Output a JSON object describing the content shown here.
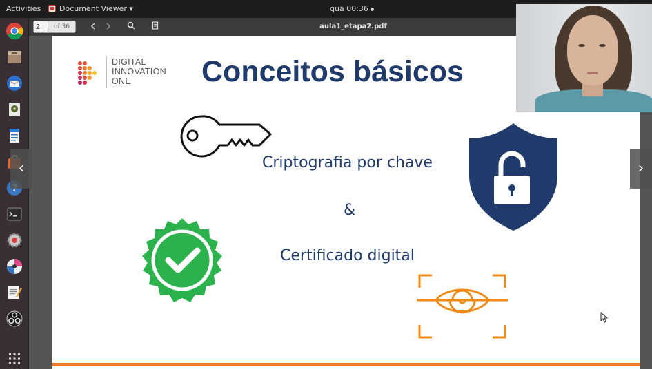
{
  "topbar": {
    "activities": "Activities",
    "app_name": "Document Viewer ▾",
    "clock": "qua 00:36"
  },
  "dock": {
    "items": [
      "chrome-icon",
      "files-icon",
      "thunderbird-icon",
      "disk-icon",
      "document-icon",
      "software-center-icon",
      "help-icon",
      "terminal-icon",
      "settings-icon",
      "media-icon",
      "text-editor-icon",
      "obs-icon",
      "show-apps-icon"
    ]
  },
  "viewer": {
    "page_current": "2",
    "page_total": "of 36",
    "title": "aula1_etapa2.pdf"
  },
  "slide": {
    "logo_lines": [
      "DIGITAL",
      "INNOVATION",
      "ONE"
    ],
    "title": "Conceitos básicos",
    "text_cripto": "Criptografia por chave",
    "text_amp": "&",
    "text_cert": "Certificado digital",
    "colors": {
      "title": "#1f3a6b",
      "shield": "#1f3a6b",
      "badge": "#2bb24c",
      "accent": "#ee7d2d"
    }
  },
  "nav": {
    "prev": "‹",
    "next": "›"
  }
}
